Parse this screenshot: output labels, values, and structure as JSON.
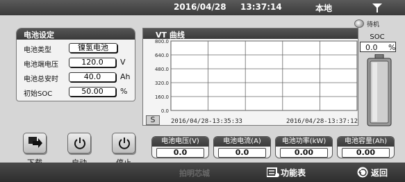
{
  "topbar": {
    "date": "2016/04/28",
    "time": "13:37:14",
    "location": "本地"
  },
  "status": {
    "standby": "待机"
  },
  "battery_settings": {
    "title": "电池设定",
    "type_label": "电池类型",
    "type_value": "镍氢电池",
    "voltage_label": "电池端电压",
    "voltage_value": "120.0",
    "voltage_unit": "V",
    "capacity_label": "电池总安时",
    "capacity_value": "40.0",
    "capacity_unit": "Ah",
    "soc_label": "初始SOC",
    "soc_value": "50.00",
    "soc_unit": "%"
  },
  "vt_curve": {
    "title": "VT 曲线",
    "s_button": "S",
    "start_time": "2016/04/28-13:35:33",
    "end_time": "2016/04/28-13:37:12"
  },
  "chart_data": {
    "type": "line",
    "title": "VT 曲线",
    "xlabel": "",
    "ylabel": "",
    "y_ticks": [
      "800.0",
      "640.0",
      "480.0",
      "320.0",
      "160.0",
      "0.0"
    ],
    "ylim": [
      0,
      800
    ],
    "x_start": "2016/04/28-13:35:33",
    "x_end": "2016/04/28-13:37:12",
    "grid": true,
    "series": []
  },
  "soc_display": {
    "label": "SOC",
    "value": "0.0",
    "unit": "%"
  },
  "buttons": {
    "download": "下载",
    "start": "启动",
    "stop": "停止"
  },
  "readouts": [
    {
      "label": "电池电压(V)",
      "value": "0.0"
    },
    {
      "label": "电池电流(A)",
      "value": "0.0"
    },
    {
      "label": "电池功率(kW)",
      "value": "0.00"
    },
    {
      "label": "电池容量(Ah)",
      "value": "0.00"
    }
  ],
  "bottombar": {
    "watermark": "拍明芯城",
    "function_table": "功能表",
    "return": "返回"
  },
  "colors": {
    "bar_dark": "#3a3a3a",
    "panel_bg": "#f2f2f2",
    "screen_bg": "#d6d6d6"
  }
}
